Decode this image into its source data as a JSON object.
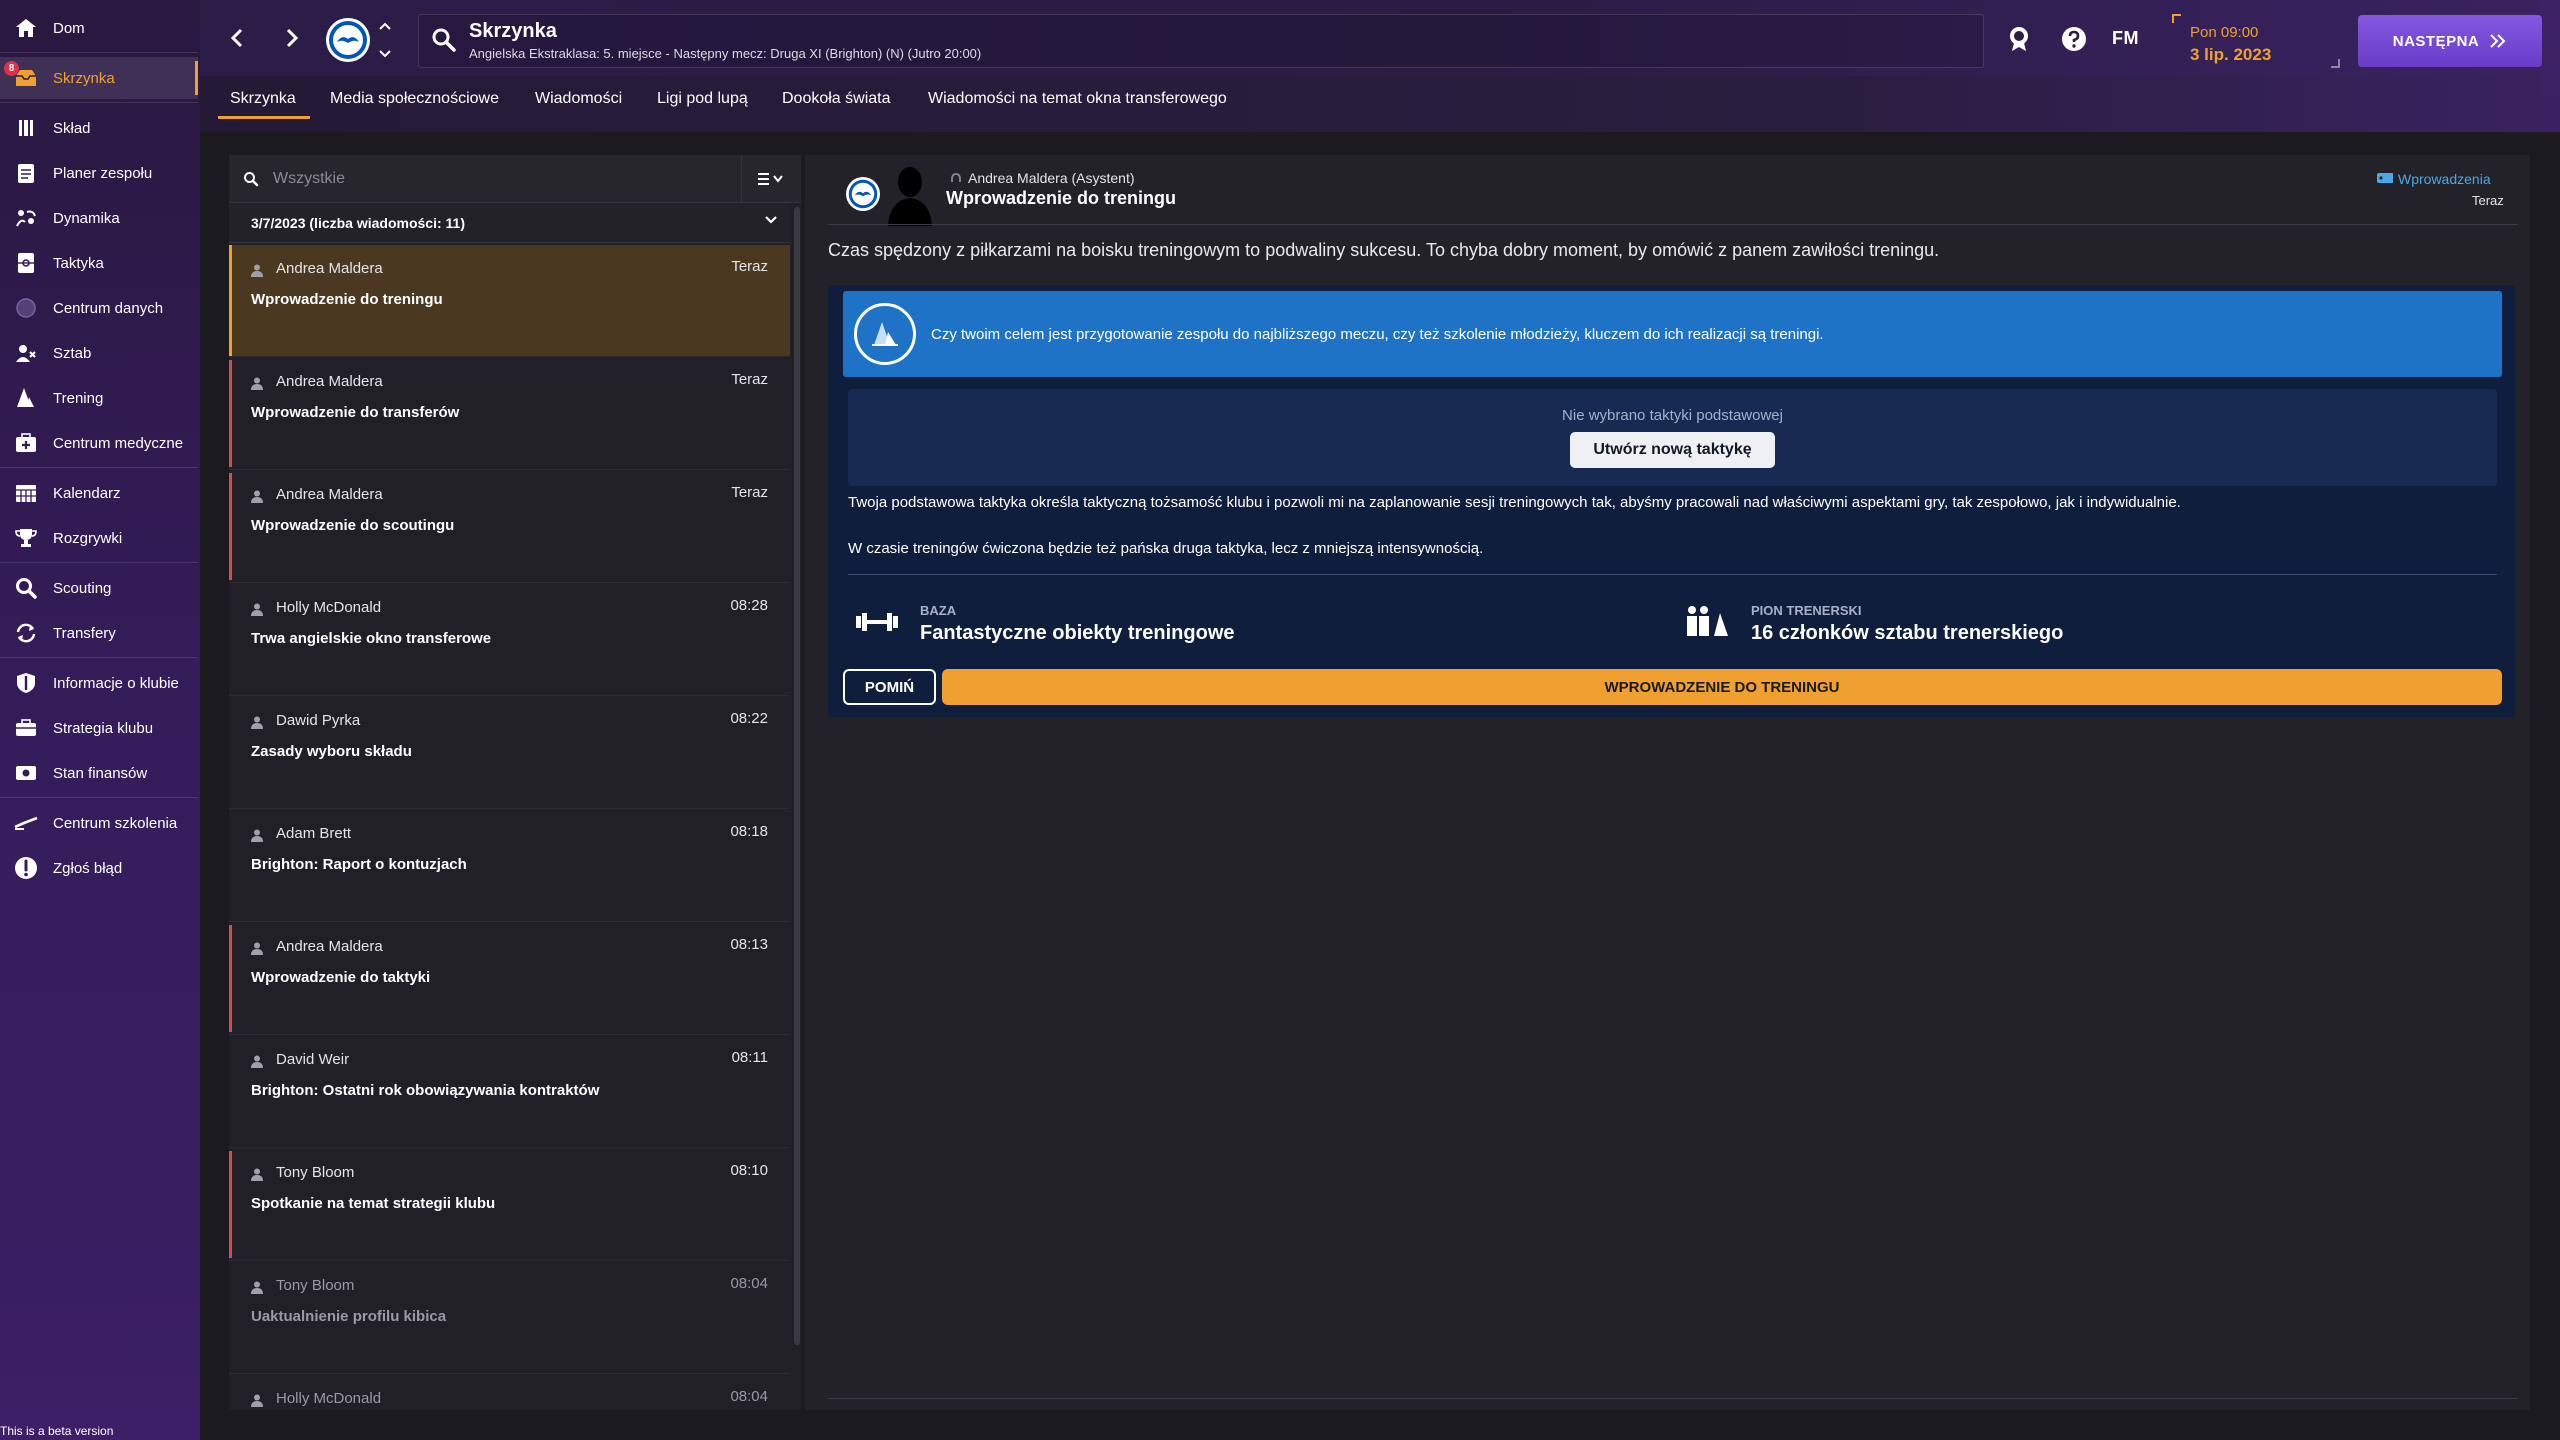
{
  "sidebar": {
    "items": [
      {
        "label": "Dom",
        "icon": "home-icon"
      },
      {
        "label": "Skrzynka",
        "icon": "inbox-icon",
        "badge": "8",
        "active": true
      },
      {
        "label": "Skład",
        "icon": "squad-icon"
      },
      {
        "label": "Planer zespołu",
        "icon": "planner-icon"
      },
      {
        "label": "Dynamika",
        "icon": "dynamics-icon"
      },
      {
        "label": "Taktyka",
        "icon": "tactics-icon"
      },
      {
        "label": "Centrum danych",
        "icon": "data-hub-icon"
      },
      {
        "label": "Sztab",
        "icon": "staff-icon"
      },
      {
        "label": "Trening",
        "icon": "training-icon"
      },
      {
        "label": "Centrum medyczne",
        "icon": "medical-icon"
      },
      {
        "label": "Kalendarz",
        "icon": "calendar-icon"
      },
      {
        "label": "Rozgrywki",
        "icon": "trophy-icon"
      },
      {
        "label": "Scouting",
        "icon": "scouting-icon"
      },
      {
        "label": "Transfery",
        "icon": "transfers-icon"
      },
      {
        "label": "Informacje o klubie",
        "icon": "club-info-icon"
      },
      {
        "label": "Strategia klubu",
        "icon": "strategy-icon"
      },
      {
        "label": "Stan finansów",
        "icon": "finances-icon"
      },
      {
        "label": "Centrum szkolenia",
        "icon": "coaching-icon"
      },
      {
        "label": "Zgłoś błąd",
        "icon": "report-bug-icon"
      }
    ],
    "beta_note": "This is a beta version"
  },
  "topbar": {
    "title": "Skrzynka",
    "subtitle": "Angielska Ekstraklasa: 5. miejsce - Następny mecz: Druga XI (Brighton) (N) (Jutro 20:00)",
    "brand": "FM",
    "date_time": "Pon 09:00",
    "date_day": "3 lip. 2023",
    "next_label": "NASTĘPNA",
    "accent": "#f0a030",
    "next_color": "#7a4ad8"
  },
  "tabs": [
    {
      "label": "Skrzynka",
      "active": true
    },
    {
      "label": "Media społecznościowe"
    },
    {
      "label": "Wiadomości"
    },
    {
      "label": "Ligi pod lupą"
    },
    {
      "label": "Dookoła świata"
    },
    {
      "label": "Wiadomości na temat okna transferowego"
    }
  ],
  "inbox": {
    "search_placeholder": "Wszystkie",
    "group_label": "3/7/2023 (liczba wiadomości: 11)",
    "messages": [
      {
        "sender": "Andrea Maldera",
        "time": "Teraz",
        "subject": "Wprowadzenie do treningu",
        "selected": true
      },
      {
        "sender": "Andrea Maldera",
        "time": "Teraz",
        "subject": "Wprowadzenie do transferów",
        "flag": true
      },
      {
        "sender": "Andrea Maldera",
        "time": "Teraz",
        "subject": "Wprowadzenie do scoutingu",
        "flag": true
      },
      {
        "sender": "Holly McDonald",
        "time": "08:28",
        "subject": "Trwa angielskie okno transferowe"
      },
      {
        "sender": "Dawid Pyrka",
        "time": "08:22",
        "subject": "Zasady wyboru składu"
      },
      {
        "sender": "Adam Brett",
        "time": "08:18",
        "subject": "Brighton: Raport o kontuzjach"
      },
      {
        "sender": "Andrea Maldera",
        "time": "08:13",
        "subject": "Wprowadzenie do taktyki",
        "flag": true
      },
      {
        "sender": "David Weir",
        "time": "08:11",
        "subject": "Brighton: Ostatni rok obowiązywania kontraktów"
      },
      {
        "sender": "Tony Bloom",
        "time": "08:10",
        "subject": "Spotkanie na temat strategii klubu",
        "flag": true
      },
      {
        "sender": "Tony Bloom",
        "time": "08:04",
        "subject": "Uaktualnienie profilu kibica",
        "read": true
      },
      {
        "sender": "Holly McDonald",
        "time": "08:04",
        "subject": "",
        "read": true
      }
    ]
  },
  "detail": {
    "sender": "Andrea Maldera  (Asystent)",
    "title": "Wprowadzenie do treningu",
    "tag": "Wprowadzenia",
    "time": "Teraz",
    "intro": "Czas spędzony z piłkarzami na boisku treningowym to podwaliny sukcesu. To chyba dobry moment, by omówić z panem zawiłości treningu.",
    "banner_text": "Czy twoim celem jest przygotowanie zespołu do najbliższego meczu, czy też szkolenie młodzieży, kluczem do ich realizacji są treningi.",
    "tactic_note": "Nie wybrano taktyki podstawowej",
    "create_tactic_label": "Utwórz nową taktykę",
    "para1": "Twoja podstawowa taktyka określa taktyczną tożsamość klubu i pozwoli mi na zaplanowanie sesji treningowych tak, abyśmy pracowali nad właściwymi aspektami gry, tak zespołowo, jak i indywidualnie.",
    "para2": "W czasie treningów ćwiczona będzie też pańska druga taktyka, lecz z mniejszą intensywnością.",
    "stats": [
      {
        "caption": "BAZA",
        "value": "Fantastyczne obiekty treningowe",
        "icon": "dumbbell-icon"
      },
      {
        "caption": "PION TRENERSKI",
        "value": "16 członków sztabu trenerskiego",
        "icon": "coaches-icon"
      }
    ],
    "skip_label": "POMIŃ",
    "action_label": "WPROWADZENIE DO TRENINGU",
    "banner_color": "#1f73c6",
    "card_color": "#101e3e"
  }
}
